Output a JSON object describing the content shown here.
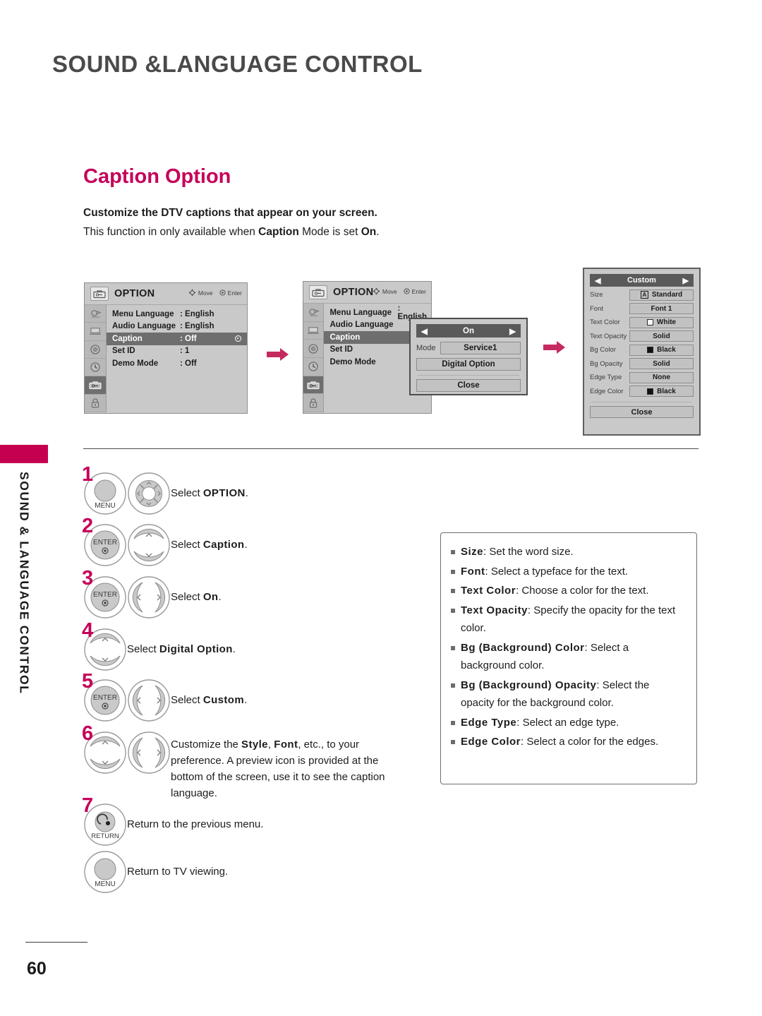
{
  "header": {
    "title": "SOUND &LANGUAGE CONTROL"
  },
  "sidebar": {
    "label": "SOUND & LANGUAGE CONTROL",
    "accent_color": "#c60050"
  },
  "section": {
    "heading": "Caption Option",
    "heading_color": "#c6005a",
    "intro_line1": "Customize the DTV captions that appear on your screen.",
    "intro_line2_a": "This function in only available when ",
    "intro_line2_b": "Caption",
    "intro_line2_c": " Mode is set ",
    "intro_line2_d": "On",
    "intro_line2_e": "."
  },
  "osd1": {
    "title": "OPTION",
    "hint_move": "Move",
    "hint_enter": "Enter",
    "rows": [
      {
        "label": "Menu Language",
        "value": ": English",
        "selected": false
      },
      {
        "label": "Audio Language",
        "value": ": English",
        "selected": false
      },
      {
        "label": "Caption",
        "value": ": Off",
        "selected": true
      },
      {
        "label": "Set ID",
        "value": ": 1",
        "selected": false
      },
      {
        "label": "Demo Mode",
        "value": ": Off",
        "selected": false
      }
    ],
    "rail_icons": [
      "picture-icon",
      "screen-icon",
      "audio-icon",
      "time-icon",
      "option-icon",
      "lock-icon"
    ]
  },
  "osd2": {
    "title": "OPTION",
    "hint_move": "Move",
    "hint_enter": "Enter",
    "rows": [
      {
        "label": "Menu Language",
        "value": ": English",
        "selected": false
      },
      {
        "label": "Audio Language",
        "value": "",
        "selected": false
      },
      {
        "label": "Caption",
        "value": "",
        "selected": true
      },
      {
        "label": "Set ID",
        "value": "",
        "selected": false
      },
      {
        "label": "Demo Mode",
        "value": "",
        "selected": false
      }
    ]
  },
  "caption_popup": {
    "value": "On",
    "mode_label": "Mode",
    "mode_value": "Service1",
    "digital_option": "Digital Option",
    "close": "Close"
  },
  "custom_panel": {
    "title": "Custom",
    "close": "Close",
    "rows": [
      {
        "label": "Size",
        "value": "Standard",
        "marker": "a-box",
        "swatch": ""
      },
      {
        "label": "Font",
        "value": "Font 1",
        "marker": "none",
        "swatch": ""
      },
      {
        "label": "Text Color",
        "value": "White",
        "marker": "swatch",
        "swatch": "#ffffff"
      },
      {
        "label": "Text Opacity",
        "value": "Solid",
        "marker": "none",
        "swatch": ""
      },
      {
        "label": "Bg Color",
        "value": "Black",
        "marker": "swatch",
        "swatch": "#111111"
      },
      {
        "label": "Bg Opacity",
        "value": "Solid",
        "marker": "none",
        "swatch": ""
      },
      {
        "label": "Edge Type",
        "value": "None",
        "marker": "none",
        "swatch": ""
      },
      {
        "label": "Edge Color",
        "value": "Black",
        "marker": "swatch",
        "swatch": "#111111"
      }
    ]
  },
  "flow_arrow_color": "#c6295f",
  "steps": [
    {
      "num": "1",
      "buttons": [
        "menu-button",
        "navigation-pad"
      ],
      "text_a": "Select ",
      "text_b": "OPTION",
      "text_c": "."
    },
    {
      "num": "2",
      "buttons": [
        "enter-button",
        "up-down-button"
      ],
      "text_a": "Select ",
      "text_b": "Caption",
      "text_c": "."
    },
    {
      "num": "3",
      "buttons": [
        "enter-button",
        "left-right-button"
      ],
      "text_a": "Select ",
      "text_b": "On",
      "text_c": "."
    },
    {
      "num": "4",
      "buttons": [
        "up-down-button"
      ],
      "text_a": "Select ",
      "text_b": "Digital Option",
      "text_c": "."
    },
    {
      "num": "5",
      "buttons": [
        "enter-button",
        "left-right-button"
      ],
      "text_a": "Select ",
      "text_b": "Custom",
      "text_c": "."
    },
    {
      "num": "6",
      "buttons": [
        "up-down-button",
        "left-right-button"
      ],
      "text_a": "Customize the ",
      "text_b": "Style",
      "text_c": ", ",
      "text_d": "Font",
      "text_e": ", etc., to your preference. A preview icon is provided at the bottom of the screen, use it to see the caption language."
    },
    {
      "num": "7",
      "buttons": [
        "return-button"
      ],
      "text_a": "Return to the previous menu.",
      "text_b": "",
      "text_c": ""
    },
    {
      "num": "",
      "buttons": [
        "menu-button"
      ],
      "text_a": "Return to TV viewing.",
      "text_b": "",
      "text_c": ""
    }
  ],
  "descriptions": [
    {
      "term": "Size",
      "desc": ": Set the word size."
    },
    {
      "term": "Font",
      "desc": ": Select a typeface for the text."
    },
    {
      "term": "Text Color",
      "desc": ": Choose a color for the text."
    },
    {
      "term": "Text Opacity",
      "desc": ": Specify the opacity for the text color."
    },
    {
      "term": "Bg (Background) Color",
      "desc": ": Select a background color."
    },
    {
      "term": "Bg (Background) Opacity",
      "desc": ": Select the opacity for the background color."
    },
    {
      "term": "Edge Type",
      "desc": ": Select an edge type."
    },
    {
      "term": "Edge Color",
      "desc": ": Select a color for the edges."
    }
  ],
  "footer": {
    "page_number": "60"
  }
}
